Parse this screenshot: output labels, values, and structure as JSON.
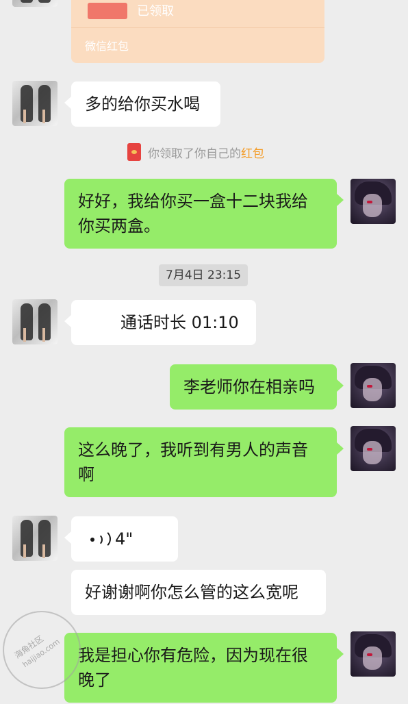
{
  "red_packet": {
    "status": "已领取",
    "footer": "微信红包"
  },
  "messages": [
    {
      "side": "left",
      "text": "多的给你买水喝"
    },
    {
      "side": "right",
      "lines": [
        "好好，我给你买一盒十二块我给",
        "你买两盒。"
      ]
    },
    {
      "side": "left",
      "text": "通话时长 01:10"
    },
    {
      "side": "right",
      "text": "李老师你在相亲吗"
    },
    {
      "side": "right",
      "lines": [
        "这么晚了，我听到有男人的声音",
        "啊"
      ]
    },
    {
      "side": "left",
      "voice_duration": "4\""
    },
    {
      "side": "left",
      "text": "好谢谢啊你怎么管的这么宽呢"
    },
    {
      "side": "right",
      "lines": [
        "我是担心你有危险，因为现在很",
        "晚了"
      ]
    }
  ],
  "system_notice": {
    "prefix": "你领取了你自己的",
    "highlight": "红包",
    "highlight_color": "#f49a22"
  },
  "timestamp": "7月4日 23:15",
  "watermark": {
    "main": "海角社区",
    "sub": "haijiao.com"
  },
  "colors": {
    "background": "#ededed",
    "sent_bubble": "#95ec69",
    "received_bubble": "#ffffff",
    "red_packet": "#fbdcc0"
  }
}
